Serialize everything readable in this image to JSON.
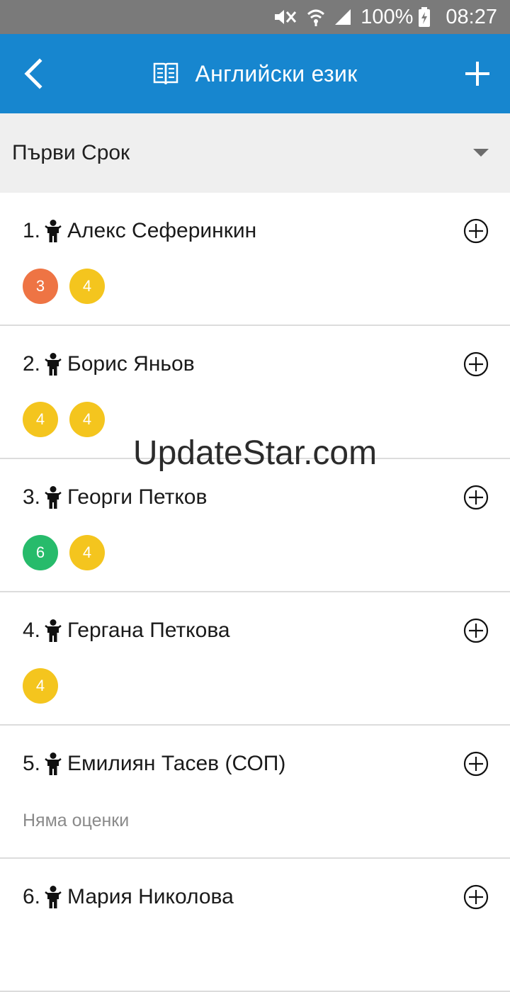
{
  "status_bar": {
    "battery": "100%",
    "time": "08:27",
    "icons": [
      "mute-icon",
      "wifi-icon",
      "signal-icon",
      "battery-charging-icon"
    ]
  },
  "app_bar": {
    "title": "Английски език",
    "icons": [
      "back-arrow-icon",
      "book-icon",
      "plus-icon"
    ]
  },
  "term": {
    "selected": "Първи Срок"
  },
  "students": [
    {
      "number": "1.",
      "name": "Алекс Сеферинкин",
      "grades": [
        {
          "value": "3",
          "color": "#ee7444"
        },
        {
          "value": "4",
          "color": "#f4c51e"
        }
      ],
      "empty_text": ""
    },
    {
      "number": "2.",
      "name": "Борис Яньов",
      "grades": [
        {
          "value": "4",
          "color": "#f4c51e"
        },
        {
          "value": "4",
          "color": "#f4c51e"
        }
      ],
      "empty_text": ""
    },
    {
      "number": "3.",
      "name": "Георги Петков",
      "grades": [
        {
          "value": "6",
          "color": "#27bb6b"
        },
        {
          "value": "4",
          "color": "#f4c51e"
        }
      ],
      "empty_text": ""
    },
    {
      "number": "4.",
      "name": "Гергана Петкова",
      "grades": [
        {
          "value": "4",
          "color": "#f4c51e"
        }
      ],
      "empty_text": ""
    },
    {
      "number": "5.",
      "name": "Емилиян Тасев (СОП)",
      "grades": [],
      "empty_text": "Няма оценки"
    },
    {
      "number": "6.",
      "name": "Мария Николова",
      "grades": [],
      "empty_text": ""
    }
  ],
  "watermark": "UpdateStar.com",
  "colors": {
    "app_bar": "#1786cf",
    "status_bar": "#7a7a7a",
    "term_bg": "#efefef"
  }
}
